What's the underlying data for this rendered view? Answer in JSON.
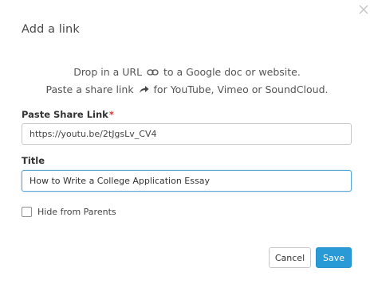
{
  "dialog": {
    "title": "Add a link",
    "close_icon": "close-icon"
  },
  "instructions": {
    "line1_before": "Drop in a URL",
    "line1_icon": "link-icon",
    "line1_after": "to a Google doc or website.",
    "line2_before": "Paste a share link",
    "line2_icon": "share-arrow-icon",
    "line2_after": "for YouTube, Vimeo or SoundCloud."
  },
  "share_link": {
    "label": "Paste Share Link",
    "required_marker": "*",
    "value": "https://youtu.be/2tJgsLv_CV4"
  },
  "title_field": {
    "label": "Title",
    "value": "How to Write a College Application Essay"
  },
  "hide_from_parents": {
    "label": "Hide from Parents",
    "checked": false
  },
  "buttons": {
    "cancel": "Cancel",
    "save": "Save"
  },
  "colors": {
    "accent": "#2a9ad6",
    "required": "#d9342b",
    "focus_border": "#5aa7d8"
  }
}
